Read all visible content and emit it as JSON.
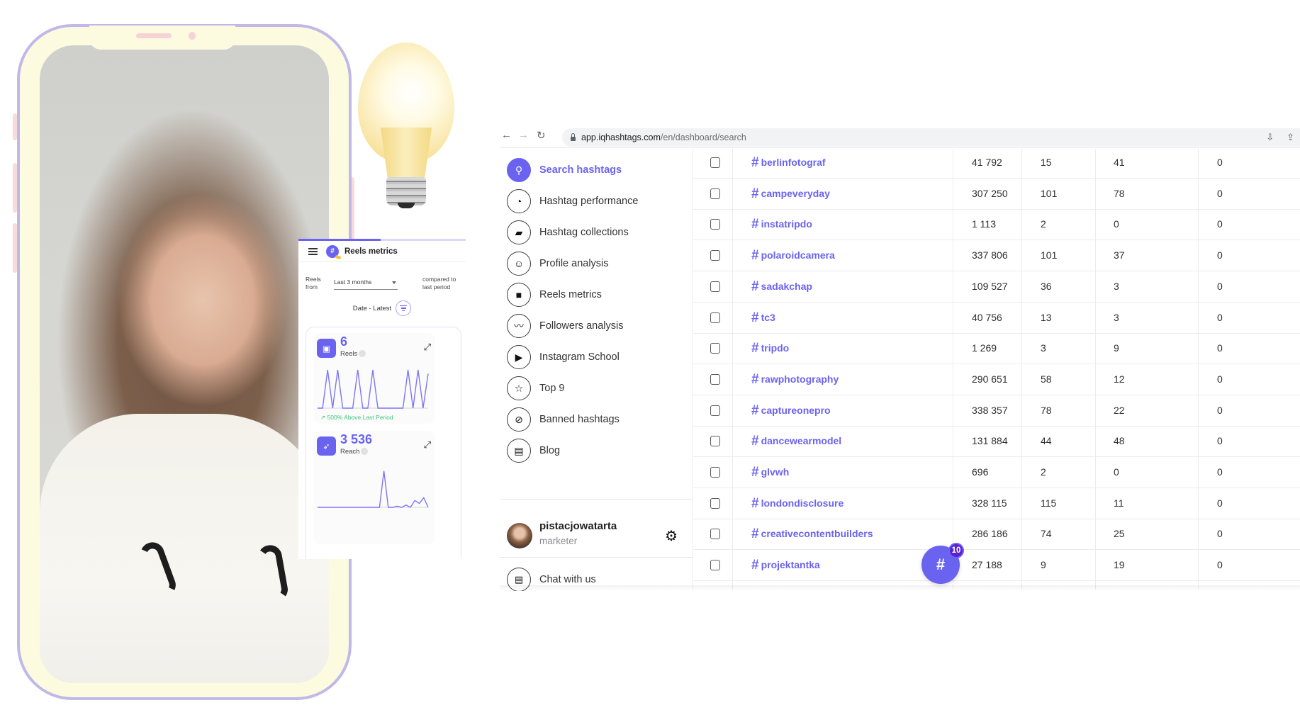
{
  "phone": {
    "label": "Phone video frame"
  },
  "reels_panel": {
    "title": "Reels metrics",
    "filter": {
      "from_label": "Reels from",
      "period_value": "Last 3 months",
      "compare_label": "compared to last period"
    },
    "sort_label": "Date -  Latest",
    "progress_fraction": 0.49,
    "cards": [
      {
        "value": "6",
        "label": "Reels",
        "icon": "clapper-icon",
        "trend_text": "500%  Above Last Period",
        "trend_arrow": "↗",
        "series": [
          0,
          0,
          1,
          0,
          1,
          0,
          0,
          0,
          1,
          0,
          0,
          1,
          0,
          0,
          0,
          0,
          0,
          0,
          1,
          0,
          1,
          0,
          0.9
        ]
      },
      {
        "value": "3 536",
        "label": "Reach",
        "icon": "rocket-icon",
        "series": [
          0,
          0,
          0,
          0,
          0,
          0,
          0,
          0,
          0,
          0,
          0,
          0,
          0,
          0,
          0,
          0.95,
          0,
          0,
          0.03,
          0,
          0.06,
          0,
          0.18,
          0.1,
          0.25,
          0
        ]
      }
    ]
  },
  "browser": {
    "url_host": "app.iqhashtags.com",
    "url_path": "/en/dashboard/search",
    "back_label": "←",
    "forward_label": "→",
    "reload_label": "↻"
  },
  "sidebar": {
    "items": [
      {
        "label": "Search hashtags",
        "icon": "search-icon",
        "glyph": "⚲",
        "active": true
      },
      {
        "label": "Hashtag performance",
        "icon": "gauge-icon",
        "glyph": "◔",
        "active": false
      },
      {
        "label": "Hashtag collections",
        "icon": "folder-star-icon",
        "glyph": "▰",
        "active": false
      },
      {
        "label": "Profile analysis",
        "icon": "face-icon",
        "glyph": "☺",
        "active": false
      },
      {
        "label": "Reels metrics",
        "icon": "video-camera-icon",
        "glyph": "■",
        "active": false
      },
      {
        "label": "Followers analysis",
        "icon": "trend-line-icon",
        "glyph": "〰",
        "active": false
      },
      {
        "label": "Instagram School",
        "icon": "play-bubble-icon",
        "glyph": "▶",
        "active": false
      },
      {
        "label": "Top 9",
        "icon": "star-icon",
        "glyph": "☆",
        "active": false
      },
      {
        "label": "Banned hashtags",
        "icon": "ban-icon",
        "glyph": "⊘",
        "active": false
      },
      {
        "label": "Blog",
        "icon": "document-icon",
        "glyph": "▤",
        "active": false
      }
    ],
    "profile": {
      "username": "pistacjowatarta",
      "role": "marketer"
    },
    "footer_items": [
      {
        "label": "Chat with us",
        "icon": "chat-icon",
        "glyph": "▭"
      }
    ]
  },
  "table": {
    "rows": [
      {
        "hashtag": "berlinfotograf",
        "c1": "41 792",
        "c2": "15",
        "c3": "41",
        "c4": "0"
      },
      {
        "hashtag": "campeveryday",
        "c1": "307 250",
        "c2": "101",
        "c3": "78",
        "c4": "0"
      },
      {
        "hashtag": "instatripdo",
        "c1": "1 113",
        "c2": "2",
        "c3": "0",
        "c4": "0"
      },
      {
        "hashtag": "polaroidcamera",
        "c1": "337 806",
        "c2": "101",
        "c3": "37",
        "c4": "0"
      },
      {
        "hashtag": "sadakchap",
        "c1": "109 527",
        "c2": "36",
        "c3": "3",
        "c4": "0"
      },
      {
        "hashtag": "tc3",
        "c1": "40 756",
        "c2": "13",
        "c3": "3",
        "c4": "0"
      },
      {
        "hashtag": "tripdo",
        "c1": "1 269",
        "c2": "3",
        "c3": "9",
        "c4": "0"
      },
      {
        "hashtag": "rawphotography",
        "c1": "290 651",
        "c2": "58",
        "c3": "12",
        "c4": "0"
      },
      {
        "hashtag": "captureonepro",
        "c1": "338 357",
        "c2": "78",
        "c3": "22",
        "c4": "0"
      },
      {
        "hashtag": "dancewearmodel",
        "c1": "131 884",
        "c2": "44",
        "c3": "48",
        "c4": "0"
      },
      {
        "hashtag": "glvwh",
        "c1": "696",
        "c2": "2",
        "c3": "0",
        "c4": "0"
      },
      {
        "hashtag": "londondisclosure",
        "c1": "328 115",
        "c2": "115",
        "c3": "11",
        "c4": "0"
      },
      {
        "hashtag": "creativecontentbuilders",
        "c1": "286 186",
        "c2": "74",
        "c3": "25",
        "c4": "0"
      },
      {
        "hashtag": "projektantka",
        "c1": "27 188",
        "c2": "9",
        "c3": "19",
        "c4": "0"
      }
    ]
  },
  "fab": {
    "glyph": "#",
    "badge_count": "10"
  },
  "colors": {
    "accent": "#6a63f0",
    "badge": "#5a20d1",
    "trend_positive": "#3fc37a",
    "phone_frame": "#c1b8e8",
    "phone_body": "#fcfbe0"
  }
}
